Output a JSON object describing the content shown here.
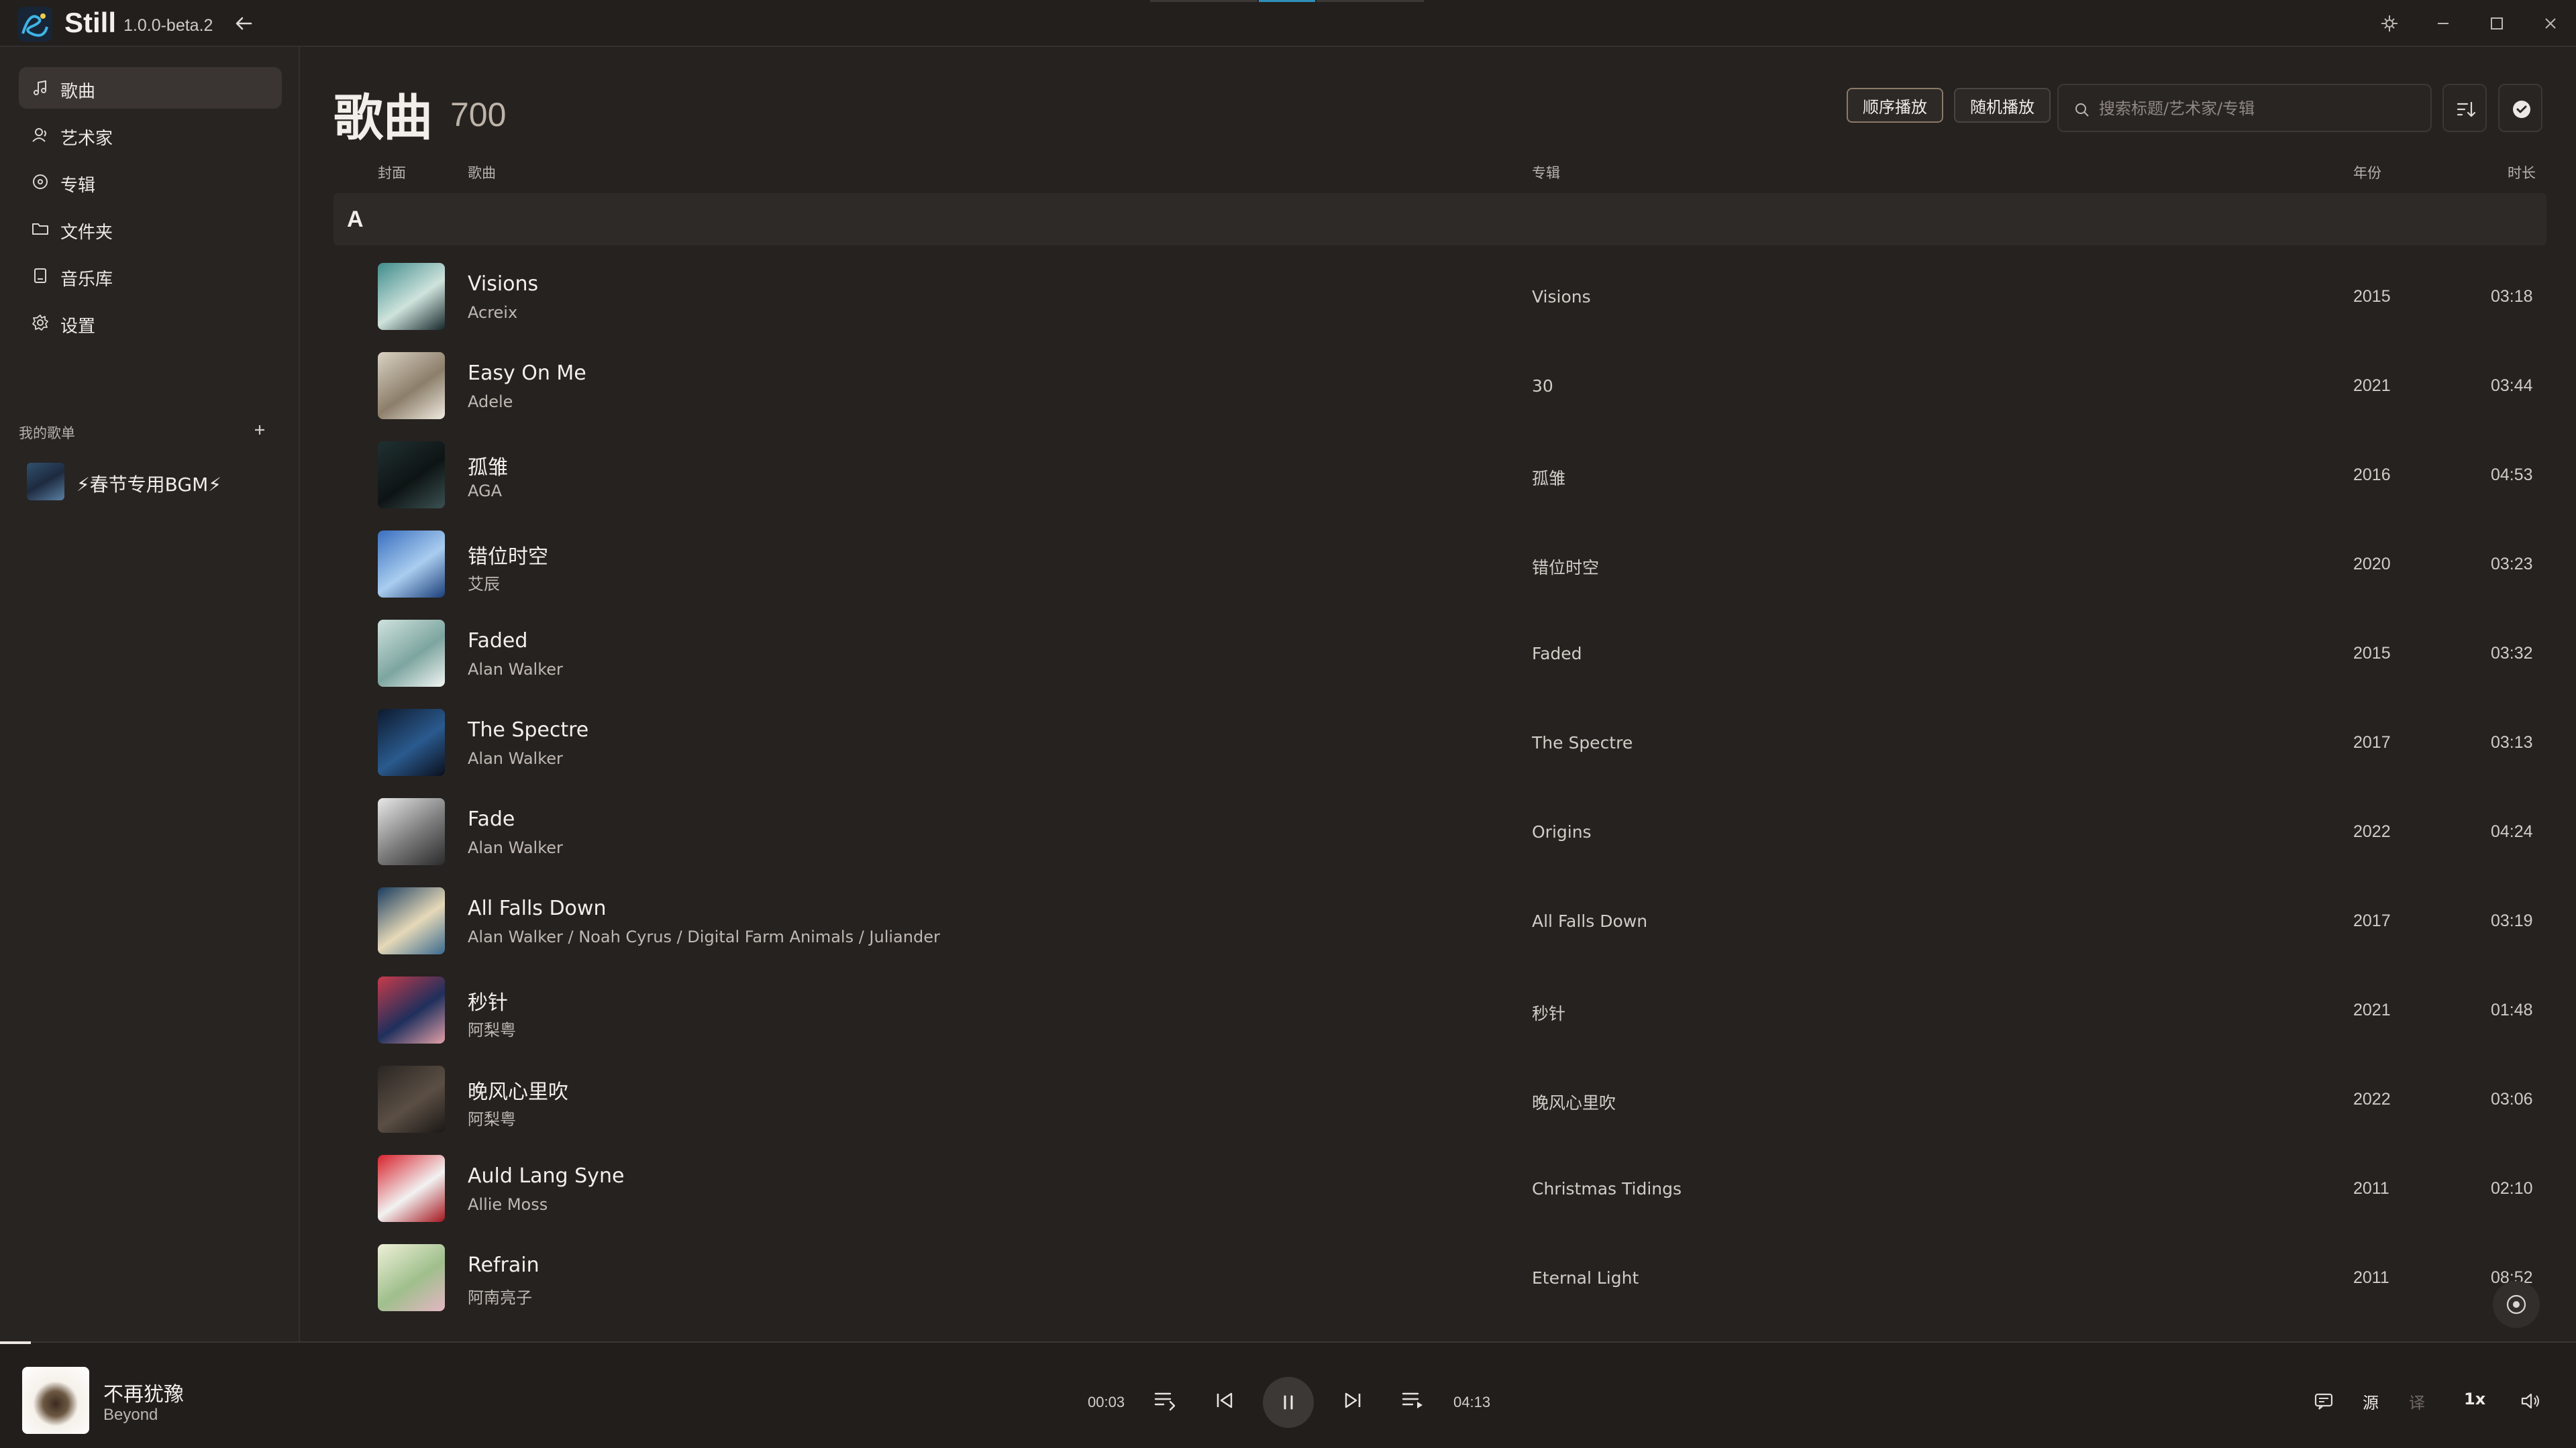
{
  "app": {
    "name": "Still",
    "version": "1.0.0-beta.2"
  },
  "icons": {
    "logo": "still-logo-icon",
    "back": "arrow-left-icon",
    "window": [
      "pin-icon",
      "minimize-icon",
      "maximize-icon",
      "close-icon"
    ]
  },
  "sidebar": {
    "items": [
      {
        "label": "歌曲",
        "icon": "music-note-icon",
        "active": true
      },
      {
        "label": "艺术家",
        "icon": "person-icon",
        "active": false
      },
      {
        "label": "专辑",
        "icon": "disc-icon",
        "active": false
      },
      {
        "label": "文件夹",
        "icon": "folder-icon",
        "active": false
      },
      {
        "label": "音乐库",
        "icon": "library-icon",
        "active": false
      },
      {
        "label": "设置",
        "icon": "gear-icon",
        "active": false
      }
    ],
    "playlists_header": "我的歌单",
    "playlists": [
      {
        "name": "⚡春节专用BGM⚡"
      }
    ]
  },
  "main": {
    "title": "歌曲",
    "count": "700",
    "buttons": {
      "sequential": "顺序播放",
      "shuffle": "随机播放"
    },
    "search": {
      "placeholder": "搜索标题/艺术家/专辑",
      "value": ""
    },
    "columns": {
      "cover": "封面",
      "song": "歌曲",
      "album": "专辑",
      "year": "年份",
      "duration": "时长"
    },
    "group_letter": "A",
    "songs": [
      {
        "title": "Visions",
        "artist": "Acreix",
        "album": "Visions",
        "year": "2015",
        "duration": "03:18",
        "cover": [
          "#3f8c8c",
          "#cfe3dc",
          "#17282c"
        ]
      },
      {
        "title": "Easy On Me",
        "artist": "Adele",
        "album": "30",
        "year": "2021",
        "duration": "03:44",
        "cover": [
          "#d9d2c3",
          "#8c7e6a",
          "#f0ebe0"
        ]
      },
      {
        "title": "孤雏",
        "artist": "AGA",
        "album": "孤雏",
        "year": "2016",
        "duration": "04:53",
        "cover": [
          "#203032",
          "#0e1414",
          "#3b5152"
        ]
      },
      {
        "title": "错位时空",
        "artist": "艾辰",
        "album": "错位时空",
        "year": "2020",
        "duration": "03:23",
        "cover": [
          "#3a6fc0",
          "#a9cdef",
          "#1c3f7a"
        ]
      },
      {
        "title": "Faded",
        "artist": "Alan Walker",
        "album": "Faded",
        "year": "2015",
        "duration": "03:32",
        "cover": [
          "#cfe2dd",
          "#7da5a0",
          "#f1f5f2"
        ]
      },
      {
        "title": "The Spectre",
        "artist": "Alan Walker",
        "album": "The Spectre",
        "year": "2017",
        "duration": "03:13",
        "cover": [
          "#0e1a2e",
          "#2a5a8e",
          "#0a0f1c"
        ]
      },
      {
        "title": "Fade",
        "artist": "Alan Walker",
        "album": "Origins",
        "year": "2022",
        "duration": "04:24",
        "cover": [
          "#e8e8e8",
          "#7a7a7a",
          "#2b2b2b"
        ]
      },
      {
        "title": "All Falls Down",
        "artist": "Alan Walker / Noah Cyrus / Digital Farm Animals / Juliander",
        "album": "All Falls Down",
        "year": "2017",
        "duration": "03:19",
        "cover": [
          "#1a3c5e",
          "#e6d9b8",
          "#3a6a8f"
        ]
      },
      {
        "title": "秒针",
        "artist": "阿梨粤",
        "album": "秒针",
        "year": "2021",
        "duration": "01:48",
        "cover": [
          "#c73b4a",
          "#1f2f5c",
          "#e3a0a8"
        ]
      },
      {
        "title": "晚风心里吹",
        "artist": "阿梨粤",
        "album": "晚风心里吹",
        "year": "2022",
        "duration": "03:06",
        "cover": [
          "#2a2622",
          "#5b4f45",
          "#1b1816"
        ]
      },
      {
        "title": "Auld Lang Syne",
        "artist": "Allie Moss",
        "album": "Christmas Tidings",
        "year": "2011",
        "duration": "02:10",
        "cover": [
          "#d7222c",
          "#f2f2f2",
          "#a3151d"
        ]
      },
      {
        "title": "Refrain",
        "artist": "阿南亮子",
        "album": "Eternal Light",
        "year": "2011",
        "duration": "08:52",
        "cover": [
          "#eef0d8",
          "#9fbf8c",
          "#e4b6c3"
        ]
      }
    ]
  },
  "player": {
    "title": "不再犹豫",
    "artist": "Beyond",
    "current_time": "00:03",
    "total_time": "04:13",
    "progress_fraction": 0.012,
    "controls": [
      "play-mode-icon",
      "previous-icon",
      "pause-icon",
      "next-icon",
      "queue-icon"
    ],
    "lyrics_source": "源",
    "lyrics_translate": "译",
    "speed": "1x",
    "right_icons": [
      "lyrics-icon",
      "volume-icon"
    ]
  }
}
